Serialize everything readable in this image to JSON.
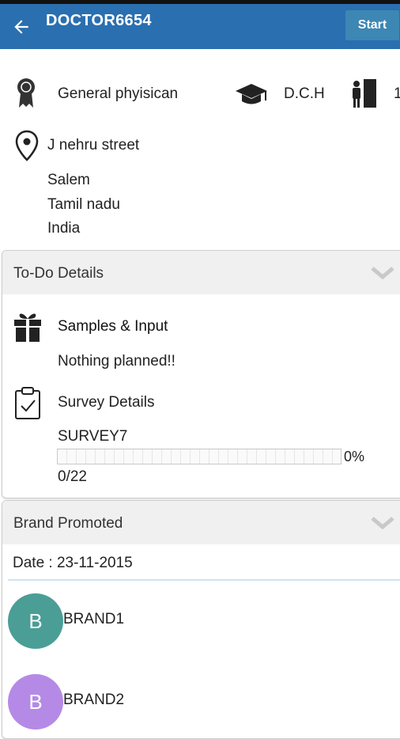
{
  "header": {
    "title": "DOCTOR6654",
    "start_label": "Start",
    "color": "#2a6fb0"
  },
  "profile": {
    "specialty": "General phyisican",
    "degree": "D.C.H",
    "room_prefix": "1",
    "address_line1": "J nehru street",
    "city": "Salem",
    "state": "Tamil nadu",
    "country": "India"
  },
  "todo": {
    "title": "To-Do Details",
    "samples_title": "Samples & Input",
    "samples_status": "Nothing planned!!",
    "survey_title": "Survey Details",
    "survey_name": "SURVEY7",
    "survey_percent_label": "0%",
    "survey_progress": 0,
    "survey_count": "0/22"
  },
  "brand": {
    "title": "Brand Promoted",
    "date_label": "Date : 23-11-2015",
    "items": [
      {
        "letter": "B",
        "name": "BRAND1",
        "color": "#4a9e96"
      },
      {
        "letter": "B",
        "name": "BRAND2",
        "color": "#b58ae6"
      }
    ]
  }
}
